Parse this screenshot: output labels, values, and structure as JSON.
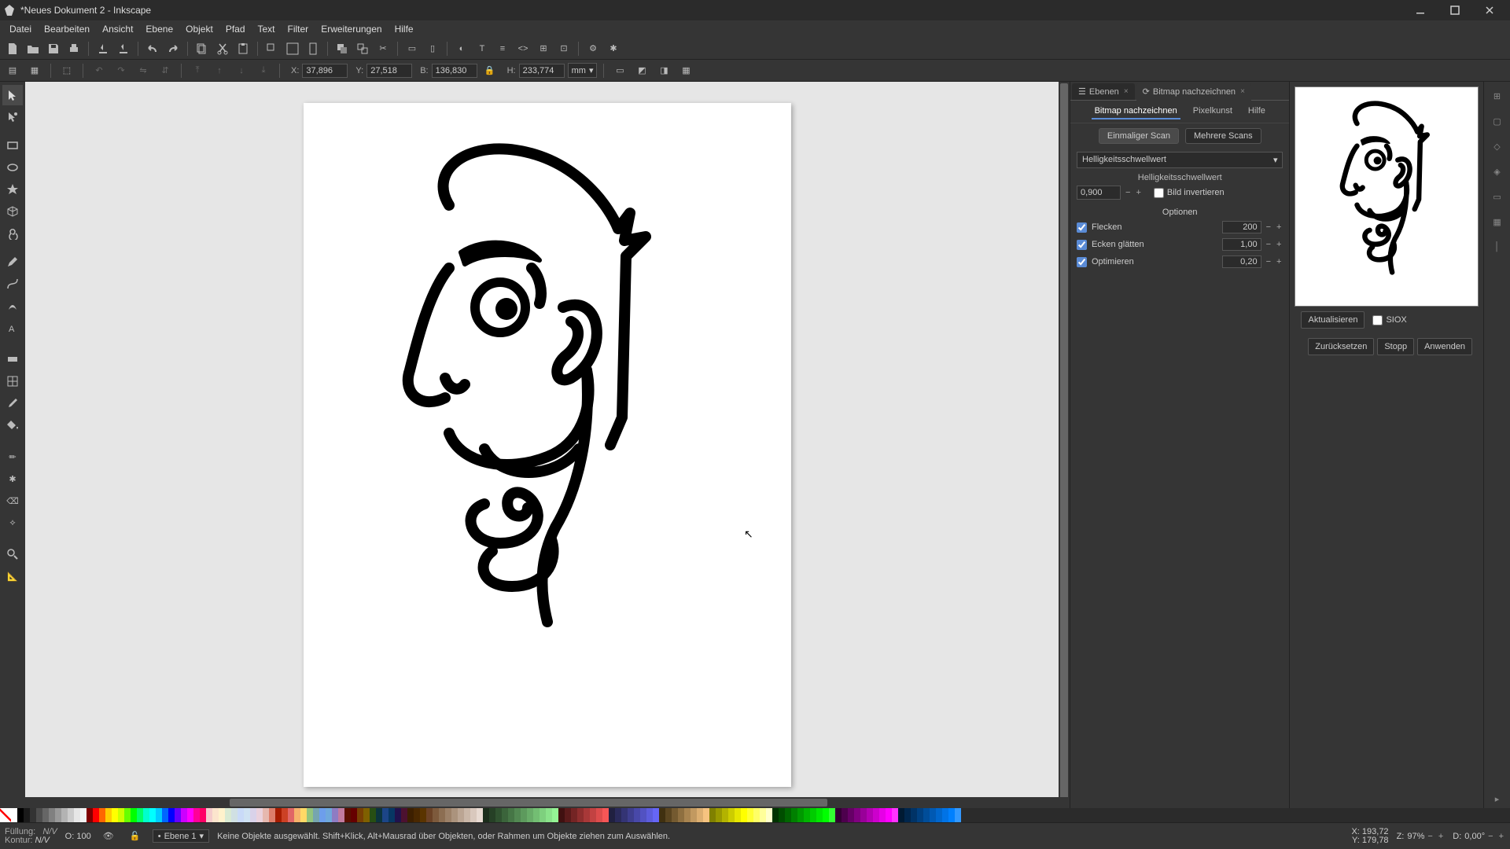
{
  "window": {
    "title": "*Neues Dokument 2 - Inkscape"
  },
  "menu": {
    "items": [
      "Datei",
      "Bearbeiten",
      "Ansicht",
      "Ebene",
      "Objekt",
      "Pfad",
      "Text",
      "Filter",
      "Erweiterungen",
      "Hilfe"
    ]
  },
  "coords": {
    "x_label": "X:",
    "x": "37,896",
    "y_label": "Y:",
    "y": "27,518",
    "b_label": "B:",
    "b": "136,830",
    "h_label": "H:",
    "h": "233,774",
    "unit": "mm"
  },
  "dock": {
    "tabs": {
      "layers": "Ebenen",
      "trace": "Bitmap nachzeichnen"
    },
    "subtabs": {
      "trace": "Bitmap nachzeichnen",
      "pixel": "Pixelkunst",
      "help": "Hilfe"
    },
    "scan_single": "Einmaliger Scan",
    "scan_multi": "Mehrere Scans",
    "method": "Helligkeitsschwellwert",
    "threshold_label": "Helligkeitsschwellwert",
    "threshold": "0,900",
    "invert": "Bild invertieren",
    "options_header": "Optionen",
    "speckles": "Flecken",
    "speckles_val": "200",
    "smooth": "Ecken glätten",
    "smooth_val": "1,00",
    "optimize": "Optimieren",
    "optimize_val": "0,20",
    "update": "Aktualisieren",
    "siox": "SIOX",
    "reset": "Zurücksetzen",
    "stop": "Stopp",
    "apply": "Anwenden"
  },
  "status": {
    "fill_label": "Füllung:",
    "fill_val": "N/V",
    "stroke_label": "Kontur:",
    "stroke_val": "N/V",
    "opacity_label": "O:",
    "opacity": "100",
    "layer": "Ebene 1",
    "message": "Keine Objekte ausgewählt. Shift+Klick, Alt+Mausrad über Objekten, oder Rahmen um Objekte ziehen zum Auswählen.",
    "sx_label": "X:",
    "sx": "193,72",
    "sy_label": "Y:",
    "sy": "179,78",
    "zoom_label": "Z:",
    "zoom": "97%",
    "rot_label": "D:",
    "rot": "0,00°"
  },
  "palette_colors": [
    "#ffffff",
    "#000000",
    "#1a1a1a",
    "#333333",
    "#4d4d4d",
    "#666666",
    "#808080",
    "#999999",
    "#b3b3b3",
    "#cccccc",
    "#e6e6e6",
    "#f2f2f2",
    "#800000",
    "#ff0000",
    "#ff6600",
    "#ffcc00",
    "#ffff00",
    "#ccff00",
    "#66ff00",
    "#00ff00",
    "#00ff66",
    "#00ffcc",
    "#00ffff",
    "#00ccff",
    "#0066ff",
    "#0000ff",
    "#6600ff",
    "#cc00ff",
    "#ff00ff",
    "#ff0099",
    "#ff0066",
    "#f4cccc",
    "#fce5cd",
    "#fff2cc",
    "#d9ead3",
    "#d0e0e3",
    "#c9daf8",
    "#cfe2f3",
    "#d9d2e9",
    "#ead1dc",
    "#e6b8af",
    "#dd7e6b",
    "#a61c00",
    "#cc4125",
    "#e06666",
    "#f6b26b",
    "#ffd966",
    "#93c47d",
    "#76a5af",
    "#6d9eeb",
    "#6fa8dc",
    "#8e7cc3",
    "#c27ba0",
    "#5b0f00",
    "#660000",
    "#783f04",
    "#7f6000",
    "#274e13",
    "#0c343d",
    "#1c4587",
    "#073763",
    "#20124d",
    "#4c1130",
    "#3d1f00",
    "#4a2800",
    "#5a3400",
    "#6b4226",
    "#7d5a3c",
    "#8c6e52",
    "#9c8168",
    "#ab937d",
    "#bba593",
    "#cab7a8",
    "#d9c8bd",
    "#e8dad2",
    "#1b2d1b",
    "#264026",
    "#305230",
    "#3b643b",
    "#467646",
    "#528852",
    "#5d9a5d",
    "#68ac68",
    "#73be73",
    "#7ed07e",
    "#8ae28a",
    "#95f495",
    "#401010",
    "#5a1a1a",
    "#742424",
    "#8e2e2e",
    "#a83838",
    "#c24242",
    "#dc4c4c",
    "#f65656",
    "#202040",
    "#2a2a5a",
    "#343474",
    "#3e3e8e",
    "#4848a8",
    "#5252c2",
    "#5c5cdc",
    "#6666f6",
    "#403010",
    "#5a4520",
    "#745a30",
    "#8e6f40",
    "#a88450",
    "#c29960",
    "#dcae70",
    "#f6c380",
    "#808000",
    "#999900",
    "#b3b300",
    "#cccc00",
    "#e6e600",
    "#ffff00",
    "#ffff33",
    "#ffff66",
    "#ffff99",
    "#ffffcc",
    "#003300",
    "#004d00",
    "#006600",
    "#008000",
    "#009900",
    "#00b300",
    "#00cc00",
    "#00e600",
    "#00ff00",
    "#33ff33",
    "#330033",
    "#4d004d",
    "#660066",
    "#800080",
    "#990099",
    "#b300b3",
    "#cc00cc",
    "#e600e6",
    "#ff00ff",
    "#ff33ff",
    "#001a33",
    "#00264d",
    "#003366",
    "#004080",
    "#004d99",
    "#0059b3",
    "#0066cc",
    "#0073e6",
    "#0080ff",
    "#3399ff"
  ]
}
